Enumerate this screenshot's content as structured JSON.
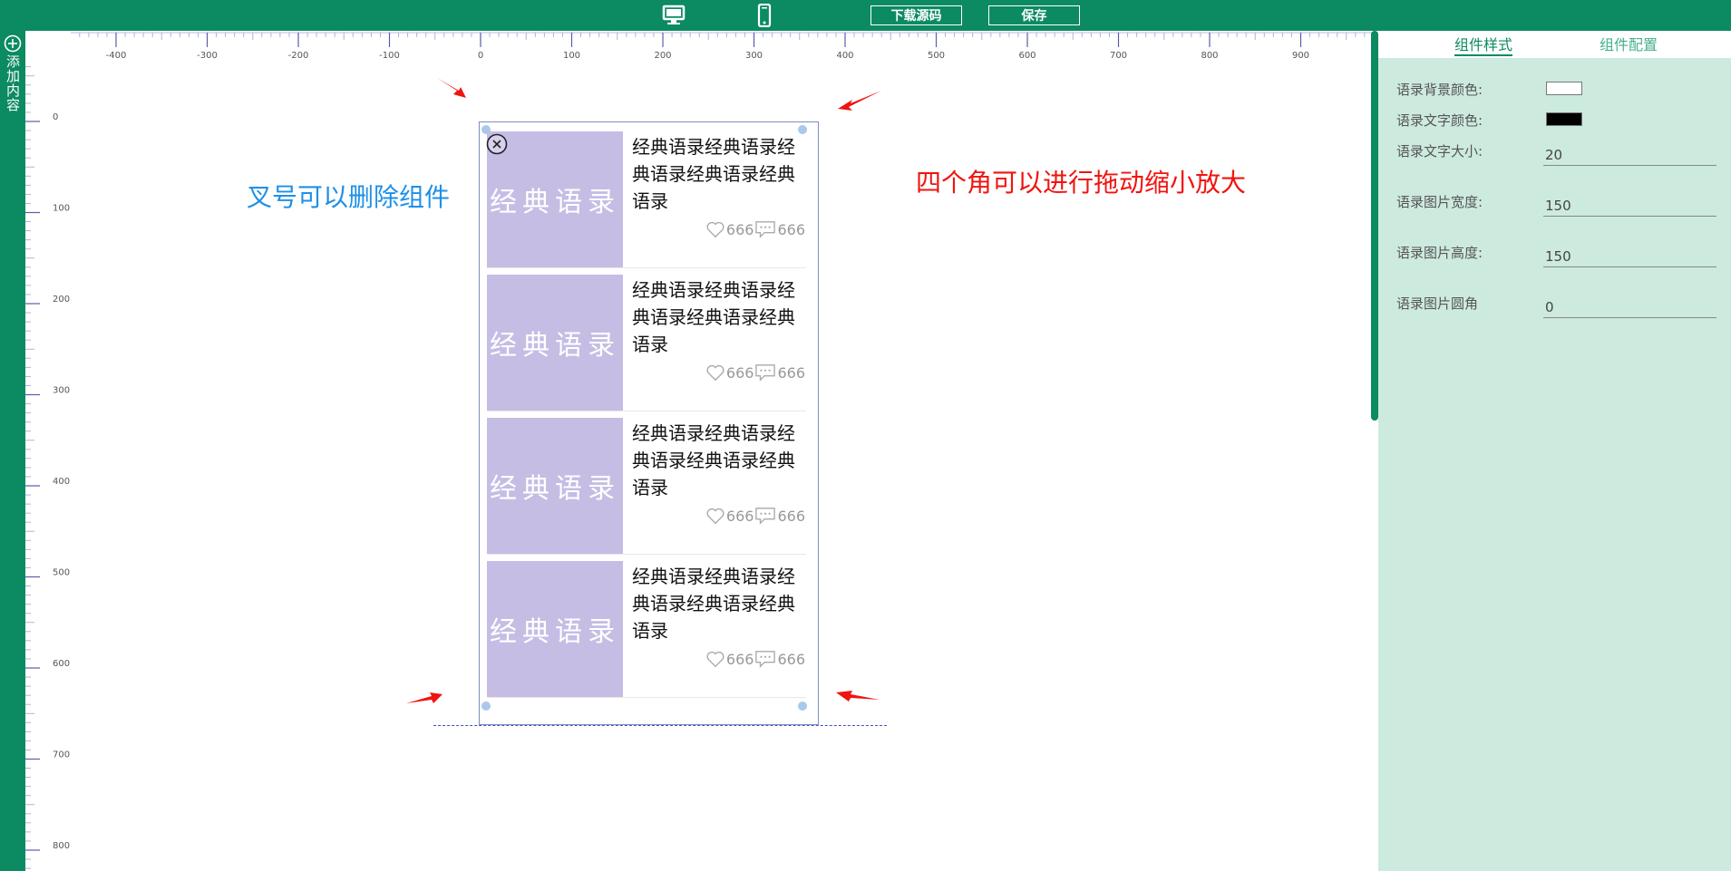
{
  "topbar": {
    "desktop_icon": "monitor-icon",
    "mobile_icon": "mobile-phone-icon",
    "download_label": "下载源码",
    "save_label": "保存"
  },
  "sidebar": {
    "add_icon": "plus-circle-icon",
    "add_label": "添加内容"
  },
  "rulers": {
    "horizontal_labels": [
      "-400",
      "-300",
      "-200",
      "-100",
      "0",
      "100",
      "200",
      "300",
      "400",
      "500",
      "600",
      "700",
      "800",
      "900"
    ],
    "vertical_labels": [
      "0",
      "100",
      "200",
      "300",
      "400",
      "500",
      "600",
      "700",
      "800"
    ]
  },
  "component": {
    "delete_icon": "close-circle-icon",
    "items": [
      {
        "image_text": "经典语录",
        "text": "经典语录经典语录经典语录经典语录经典语录",
        "likes": "666",
        "comments": "666"
      },
      {
        "image_text": "经典语录",
        "text": "经典语录经典语录经典语录经典语录经典语录",
        "likes": "666",
        "comments": "666"
      },
      {
        "image_text": "经典语录",
        "text": "经典语录经典语录经典语录经典语录经典语录",
        "likes": "666",
        "comments": "666"
      },
      {
        "image_text": "经典语录",
        "text": "经典语录经典语录经典语录经典语录经典语录",
        "likes": "666",
        "comments": "666"
      }
    ],
    "like_icon": "heart-icon",
    "comment_icon": "comment-icon"
  },
  "annotations": {
    "left": "叉号可以删除组件",
    "right": "四个角可以进行拖动缩小放大"
  },
  "panel": {
    "tabs": [
      "组件样式",
      "组件配置"
    ],
    "active_tab": "组件样式",
    "props": {
      "bg_color_label": "语录背景颜色:",
      "bg_color_value": "#ffffff",
      "text_color_label": "语录文字颜色:",
      "text_color_value": "#000000",
      "font_size_label": "语录文字大小:",
      "font_size_value": "20",
      "img_width_label": "语录图片宽度:",
      "img_width_value": "150",
      "img_height_label": "语录图片高度:",
      "img_height_value": "150",
      "img_radius_label": "语录图片圆角",
      "img_radius_value": "0"
    }
  },
  "colors": {
    "brand": "#0c8a62",
    "panel_bg": "#cdeadf",
    "image_bg": "#c5bde4",
    "annotation_blue": "#1e90e8",
    "annotation_red": "#f0140f"
  }
}
